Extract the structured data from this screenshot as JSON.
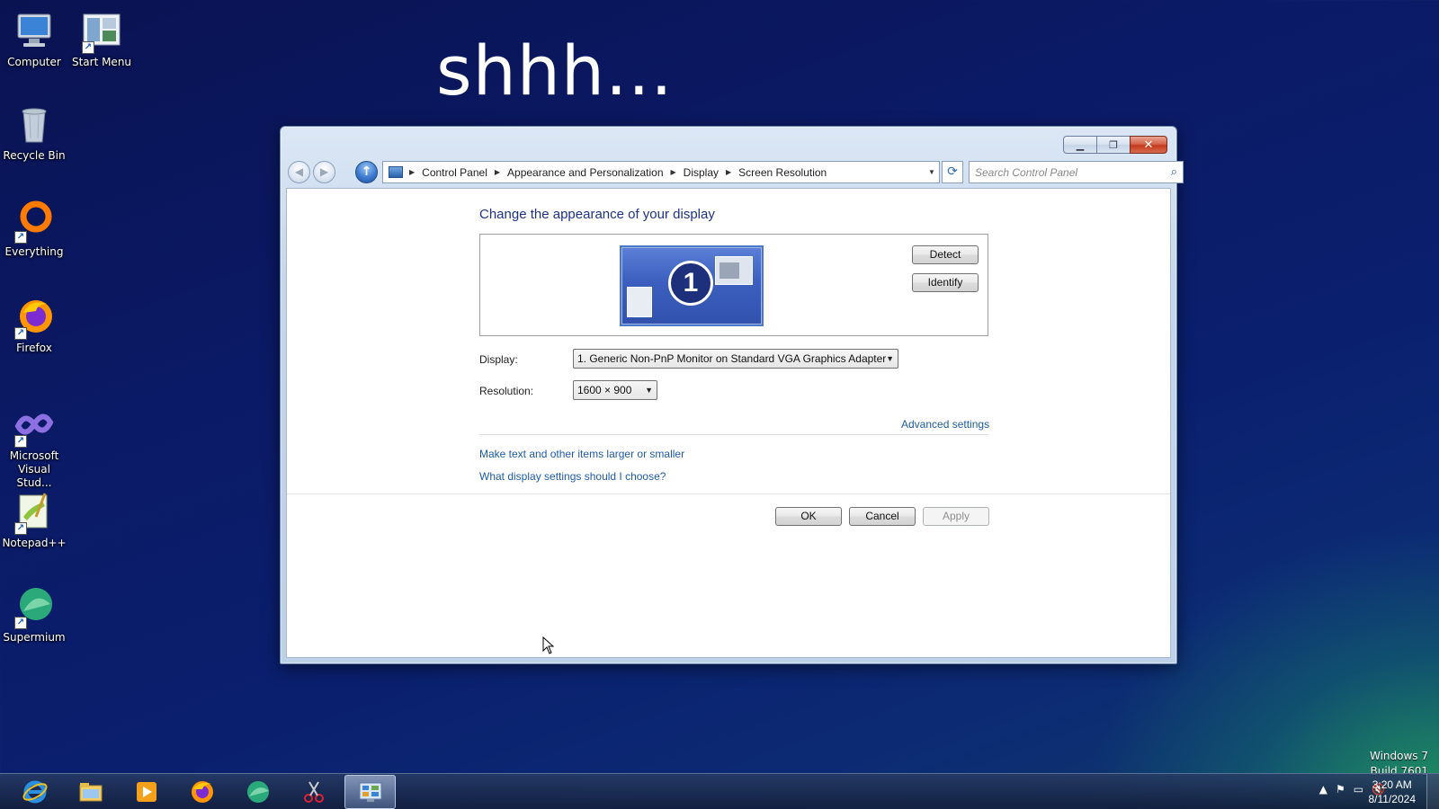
{
  "desktop": {
    "overlay_text": "shhh...",
    "watermark": {
      "line1": "Windows 7",
      "line2": "Build 7601"
    },
    "icons": [
      {
        "label": "Computer",
        "icon": "computer-icon"
      },
      {
        "label": "Start Menu",
        "icon": "start-menu-icon"
      },
      {
        "label": "Recycle Bin",
        "icon": "recycle-bin-icon"
      },
      {
        "label": "Everything",
        "icon": "everything-icon"
      },
      {
        "label": "Firefox",
        "icon": "firefox-icon"
      },
      {
        "label": "Microsoft Visual Stud...",
        "icon": "visual-studio-icon"
      },
      {
        "label": "Notepad++",
        "icon": "notepad-plus-plus-icon"
      },
      {
        "label": "Supermium",
        "icon": "supermium-icon"
      }
    ]
  },
  "window": {
    "breadcrumbs": [
      "Control Panel",
      "Appearance and Personalization",
      "Display",
      "Screen Resolution"
    ],
    "search_placeholder": "Search Control Panel",
    "title": "Change the appearance of your display",
    "monitor_number": "1",
    "buttons": {
      "detect": "Detect",
      "identify": "Identify",
      "ok": "OK",
      "cancel": "Cancel",
      "apply": "Apply"
    },
    "display_label": "Display:",
    "display_value": "1. Generic Non-PnP Monitor on Standard VGA Graphics Adapter",
    "resolution_label": "Resolution:",
    "resolution_value": "1600 × 900",
    "advanced_link": "Advanced settings",
    "links": [
      "Make text and other items larger or smaller",
      "What display settings should I choose?"
    ]
  },
  "taskbar": {
    "pinned": [
      "internet-explorer-icon",
      "file-explorer-icon",
      "media-player-icon",
      "firefox-icon",
      "supermium-icon",
      "snipping-tool-icon",
      "control-panel-icon"
    ],
    "active_index": 6,
    "clock": {
      "time": "3:20 AM",
      "date": "8/11/2024"
    }
  }
}
